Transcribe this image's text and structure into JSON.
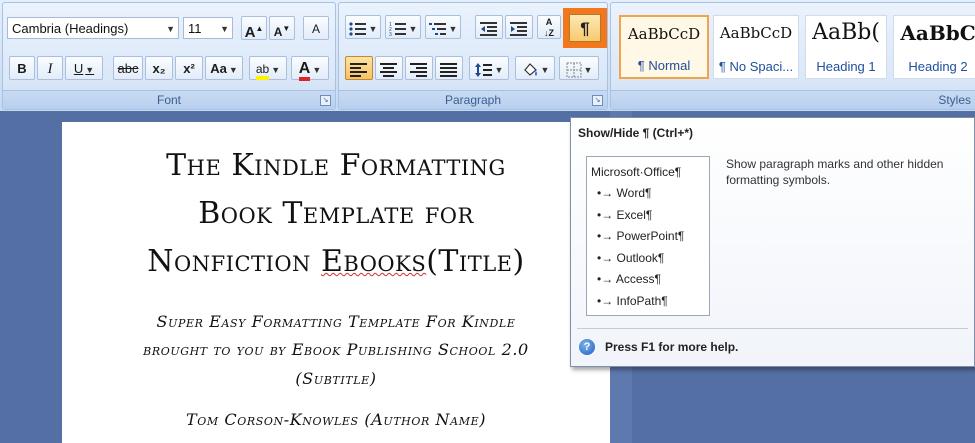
{
  "ribbon": {
    "font": {
      "font_name": "Cambria (Headings)",
      "font_size": "11",
      "grow_label": "A",
      "shrink_label": "A",
      "clear_label": "A",
      "bold": "B",
      "italic": "I",
      "underline": "U",
      "strike": "abc",
      "subscript": "x₂",
      "superscript": "x²",
      "change_case": "Aa",
      "highlight": "ab",
      "font_color": "A",
      "group_label": "Font"
    },
    "paragraph": {
      "pilcrow": "¶",
      "group_label": "Paragraph",
      "sort_label": "A↓Z"
    },
    "styles": {
      "group_label": "Styles",
      "items": [
        {
          "sample": "AaBbCcD",
          "name": "¶ Normal"
        },
        {
          "sample": "AaBbCcD",
          "name": "¶ No Spaci..."
        },
        {
          "sample": "AaBb(",
          "name": "Heading 1"
        },
        {
          "sample": "AaBbC",
          "name": "Heading 2"
        }
      ]
    }
  },
  "document": {
    "title_lines": [
      "The Kindle Formatting",
      "Book Template for",
      "Nonfiction Ebooks(Title)"
    ],
    "subtitle_lines": [
      "Super Easy Formatting Template For Kindle",
      "brought to you by Ebook Publishing School 2.0",
      "(Subtitle)"
    ],
    "author_line": "Tom Corson-Knowles (Author Name)"
  },
  "tooltip": {
    "title": "Show/Hide ¶ (Ctrl+*)",
    "preview_items": [
      "Microsoft·Office¶",
      "•→ Word¶",
      "•→ Excel¶",
      "•→ PowerPoint¶",
      "•→ Outlook¶",
      "•→ Access¶",
      "•→ InfoPath¶"
    ],
    "description": "Show paragraph marks and other hidden formatting symbols.",
    "help_icon": "?",
    "help_text": "Press F1 for more help."
  },
  "colors": {
    "accent_highlight": "#f3781d",
    "workspace": "#546fa3",
    "style_name": "#1f4f9a"
  }
}
